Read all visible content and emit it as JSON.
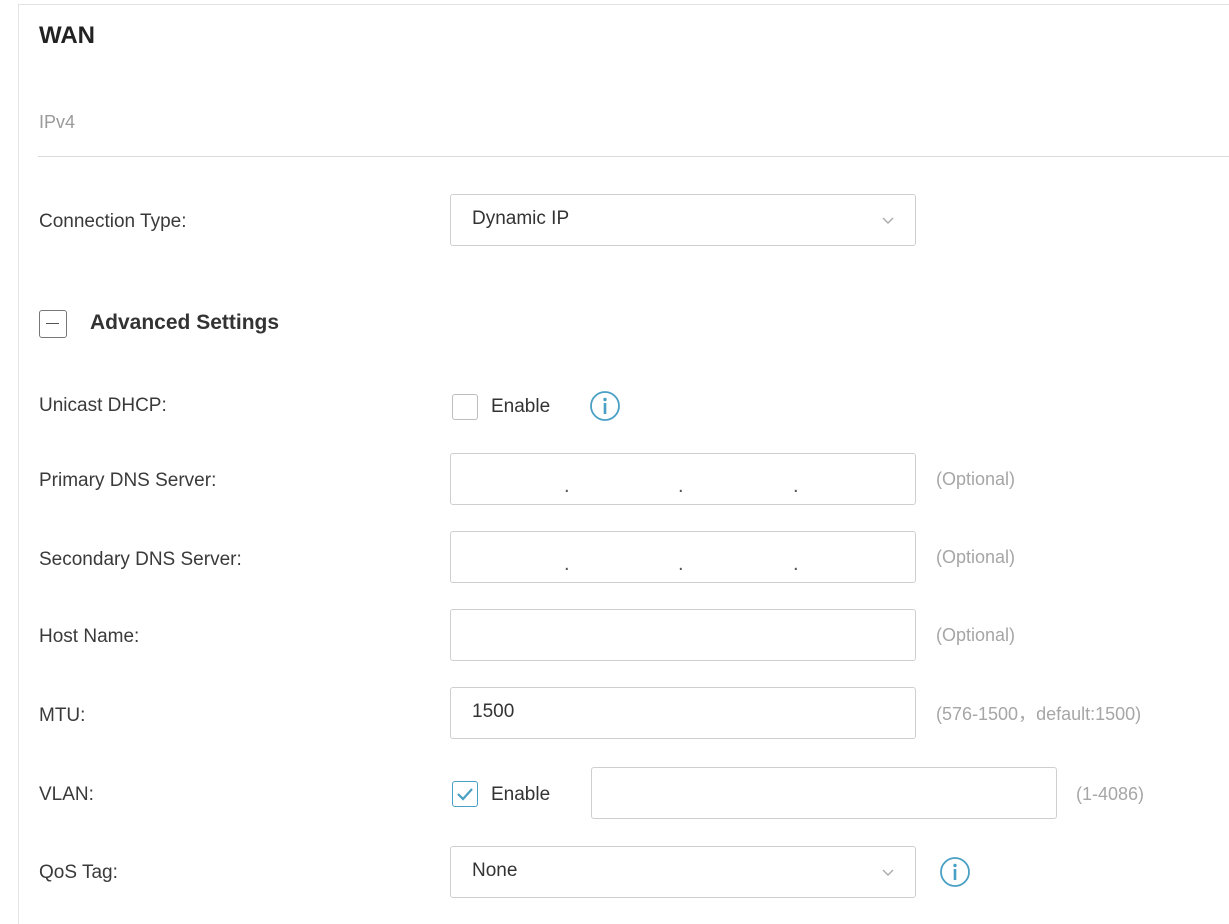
{
  "page": {
    "title": "WAN",
    "subtitle": "IPv4"
  },
  "connection_type": {
    "label": "Connection Type:",
    "value": "Dynamic IP"
  },
  "advanced": {
    "label": "Advanced Settings",
    "expanded": true
  },
  "unicast_dhcp": {
    "label": "Unicast DHCP:",
    "checkbox_label": "Enable",
    "checked": false
  },
  "primary_dns": {
    "label": "Primary DNS Server:",
    "hint": "(Optional)"
  },
  "secondary_dns": {
    "label": "Secondary DNS Server:",
    "hint": "(Optional)"
  },
  "host_name": {
    "label": "Host Name:",
    "value": "",
    "hint": "(Optional)"
  },
  "mtu": {
    "label": "MTU:",
    "value": "1500",
    "hint": "(576-1500，default:1500)"
  },
  "vlan": {
    "label": "VLAN:",
    "checkbox_label": "Enable",
    "checked": true,
    "value": "",
    "hint": "(1-4086)"
  },
  "qos_tag": {
    "label": "QoS Tag:",
    "value": "None"
  },
  "colors": {
    "accent": "#4a9fc4",
    "hint": "#a6a6a6",
    "border": "#cfcfcf"
  }
}
